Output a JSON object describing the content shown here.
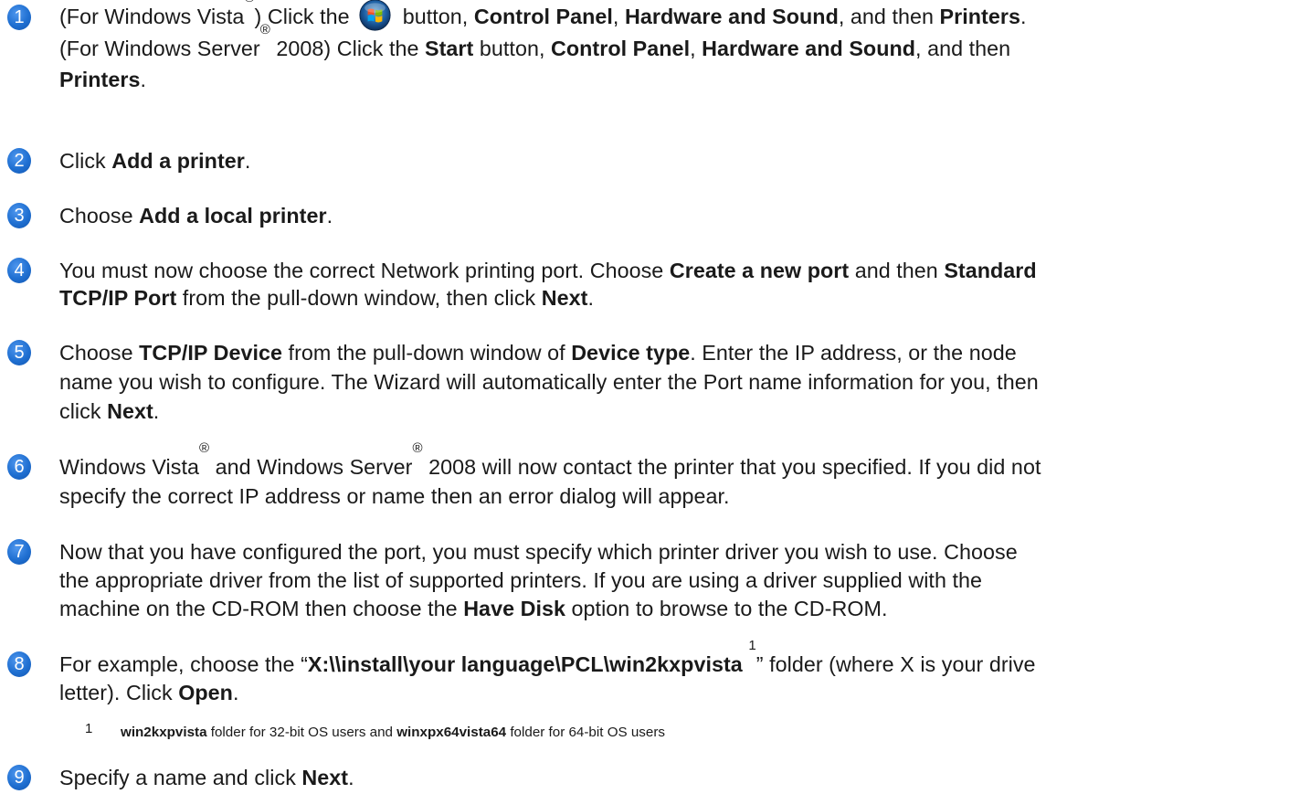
{
  "steps": [
    {
      "number": "1",
      "lines": [
        {
          "parts": [
            "(For Windows Vista",
            "®",
            ") Click the ",
            "windows-start-logo",
            " button, ",
            "Control Panel",
            ", ",
            "Hardware and Sound",
            ", and then ",
            "Printers",
            "."
          ]
        },
        {
          "parts": [
            "(For Windows Server",
            "®",
            " 2008) Click the ",
            "Start",
            " button, ",
            "Control Panel",
            ", ",
            "Hardware and Sound",
            ", and then"
          ]
        },
        {
          "parts": [
            "Printers",
            "."
          ]
        }
      ]
    },
    {
      "number": "2",
      "lines": [
        {
          "parts": [
            "Click ",
            "Add a printer",
            "."
          ]
        }
      ]
    },
    {
      "number": "3",
      "lines": [
        {
          "parts": [
            "Choose ",
            "Add a local printer",
            "."
          ]
        }
      ]
    },
    {
      "number": "4",
      "lines": [
        {
          "parts": [
            "You must now choose the correct Network printing port. Choose ",
            "Create a new port",
            " and then ",
            "Standard"
          ]
        },
        {
          "parts": [
            "TCP/IP Port",
            " from the pull-down window, then click ",
            "Next",
            "."
          ]
        }
      ]
    },
    {
      "number": "5",
      "lines": [
        {
          "parts": [
            "Choose ",
            "TCP/IP Device",
            " from the pull-down window of ",
            "Device type",
            ". Enter the IP address, or the node"
          ]
        },
        {
          "parts": [
            "name you wish to configure. The Wizard will automatically enter the Port name information for you, then"
          ]
        },
        {
          "parts": [
            "click ",
            "Next",
            "."
          ]
        }
      ]
    },
    {
      "number": "6",
      "lines": [
        {
          "parts": [
            "Windows Vista",
            "®",
            " and Windows Server",
            "®",
            " 2008 will now contact the printer that you specified. If you did not"
          ]
        },
        {
          "parts": [
            "specify the correct IP address or name then an error dialog will appear."
          ]
        }
      ]
    },
    {
      "number": "7",
      "lines": [
        {
          "parts": [
            "Now that you have configured the port, you must specify which printer driver you wish to use. Choose"
          ]
        },
        {
          "parts": [
            "the appropriate driver from the list of supported printers. If you are using a driver supplied with the"
          ]
        },
        {
          "parts": [
            "machine on the CD-ROM then choose the ",
            "Have Disk",
            " option to browse to the CD-ROM."
          ]
        }
      ]
    },
    {
      "number": "8",
      "lines": [
        {
          "parts": [
            "For example, choose the “",
            "X:\\\\install\\your language\\PCL\\win2kxpvista",
            " ",
            "1",
            "” folder (where X is your drive"
          ]
        },
        {
          "parts": [
            "letter). Click ",
            "Open",
            "."
          ]
        }
      ]
    },
    {
      "number": "9",
      "lines": [
        {
          "parts": [
            "Specify a name and click ",
            "Next",
            "."
          ]
        }
      ]
    }
  ],
  "footnote": {
    "number": "1",
    "parts": [
      "win2kxpvista",
      " folder for 32-bit OS users and ",
      "winxpx64vista64",
      " folder for 64-bit OS users"
    ]
  },
  "colors": {
    "badge": "#1f6fd1",
    "text": "#1a1a1a"
  },
  "icons": {
    "start_button": "windows-start-logo"
  }
}
